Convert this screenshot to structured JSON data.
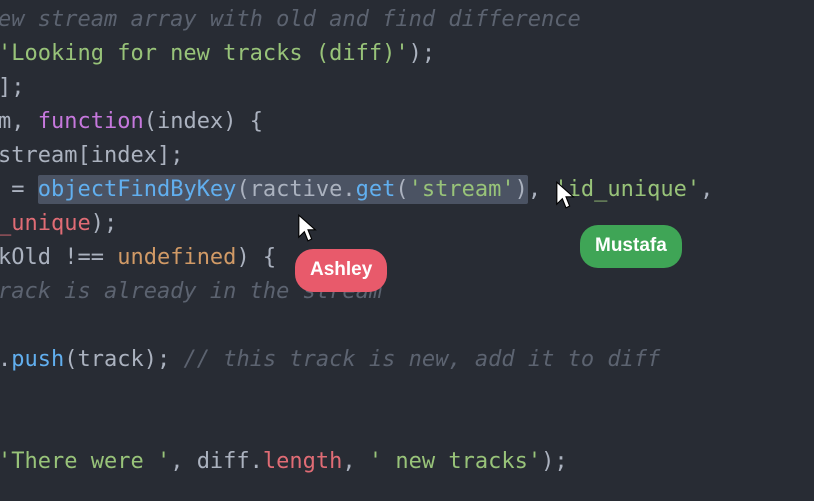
{
  "collaborators": {
    "a": {
      "name": "Ashley",
      "color": "red"
    },
    "b": {
      "name": "Mustafa",
      "color": "green"
    }
  },
  "code": {
    "l1_comment_frag": "ew stream array with old and find difference",
    "l2_string": "'Looking for new tracks (diff)'",
    "l2_tail": ");",
    "l3": "];",
    "l4_head": "m, ",
    "l4_kw": "function",
    "l4_paren_open": "(",
    "l4_param": "index",
    "l4_tail": ") {",
    "l5_head": "stream[",
    "l5_idx": "index",
    "l5_tail": "];",
    "l6_lead": " = ",
    "l6_fn": "objectFindByKey",
    "l6_p1": "(",
    "l6_obj": "ractive",
    "l6_dot": ".",
    "l6_get": "get",
    "l6_p2": "(",
    "l6_arg_stream": "'stream'",
    "l6_p3": ")",
    "l6_comma": ", ",
    "l6_arg_id": "'id_unique'",
    "l6_after": ",",
    "l7_var": "_unique",
    "l7_tail": ");",
    "l8_head": "kOld !== ",
    "l8_undef": "undefined",
    "l8_tail": ") {",
    "l9_comment": "rack is already in the stream",
    "l11_head": ".",
    "l11_push": "push",
    "l11_p1": "(",
    "l11_arg": "track",
    "l11_p2": "); ",
    "l11_comment": "// this track is new, add it to diff",
    "l14_s1": "'There were '",
    "l14_c1": ", ",
    "l14_diff": "diff",
    "l14_dot": ".",
    "l14_len": "length",
    "l14_c2": ", ",
    "l14_s2": "' new tracks'",
    "l14_tail": ");"
  }
}
